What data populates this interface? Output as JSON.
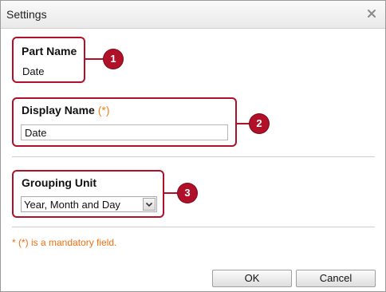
{
  "dialog": {
    "title": "Settings",
    "close_icon": "close-icon"
  },
  "part_name": {
    "label": "Part Name",
    "value": "Date"
  },
  "display_name": {
    "label": "Display Name",
    "mandatory_mark": "(*)",
    "value": "Date"
  },
  "grouping_unit": {
    "label": "Grouping Unit",
    "selected": "Year, Month and Day",
    "arrow_icon": "chevron-down-icon"
  },
  "note": "* (*) is a mandatory field.",
  "buttons": {
    "ok": "OK",
    "cancel": "Cancel"
  },
  "callouts": [
    "1",
    "2",
    "3"
  ],
  "colors": {
    "callout": "#b01028",
    "mandatory": "#f07010"
  }
}
